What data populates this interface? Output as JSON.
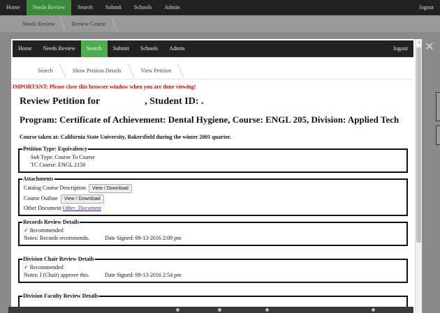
{
  "background": {
    "nav": [
      "Home",
      "Needs Review",
      "Search",
      "Submit",
      "Schools",
      "Admin"
    ],
    "active_nav": "Needs Review",
    "logout": "logout",
    "breadcrumbs": [
      "Needs Review",
      "Review Course"
    ]
  },
  "modal": {
    "nav": [
      "Home",
      "Needs Review",
      "Search",
      "Submit",
      "Schools",
      "Admin"
    ],
    "active_nav": "Search",
    "logout": "logout",
    "breadcrumbs": [
      "Search",
      "Show Petition Details",
      "View Petition"
    ],
    "close_glyph": "✕",
    "scroll_up_glyph": "^"
  },
  "page": {
    "important": "IMPORTANT: Please close this browser window when you are done viewing!",
    "review_title_prefix": "Review Petition for",
    "review_title_suffix": ", Student ID: .",
    "program_title": "Program: Certificate of Achievement: Dental Hygiene, Course: ENGL 205, Division: Applied Tech",
    "course_taken": "Course taken at: California State University, Bakersfield during the winter 2001 quarter."
  },
  "petition_type": {
    "legend": "Petition Type: Equivalency",
    "sub_type": "Sub Type: Course To Course",
    "tc_course": "TC Course: ENGL 2150"
  },
  "attachments": {
    "legend": "Attachments",
    "catalog_label": "Catalog Course Description",
    "catalog_button": "View / Download",
    "outline_label": "Course Outline",
    "outline_button": "View / Download",
    "other_label": "Other Document",
    "other_link": "Other_Document"
  },
  "records_review": {
    "legend": "Records Review Details",
    "check": "✓",
    "status": "Recommended",
    "notes": "Notes: Records recommends.",
    "date": "Date Signed: 09-13-2016 2:09 pm"
  },
  "division_chair": {
    "legend": "Division Chair Review Details",
    "check": "✓",
    "status": "Recommended",
    "notes": "Notes: I (Chair) approve this.",
    "date": "Date Signed: 09-13-2016 2:54 pm"
  },
  "division_faculty": {
    "legend": "Division Faculty Review Details"
  }
}
